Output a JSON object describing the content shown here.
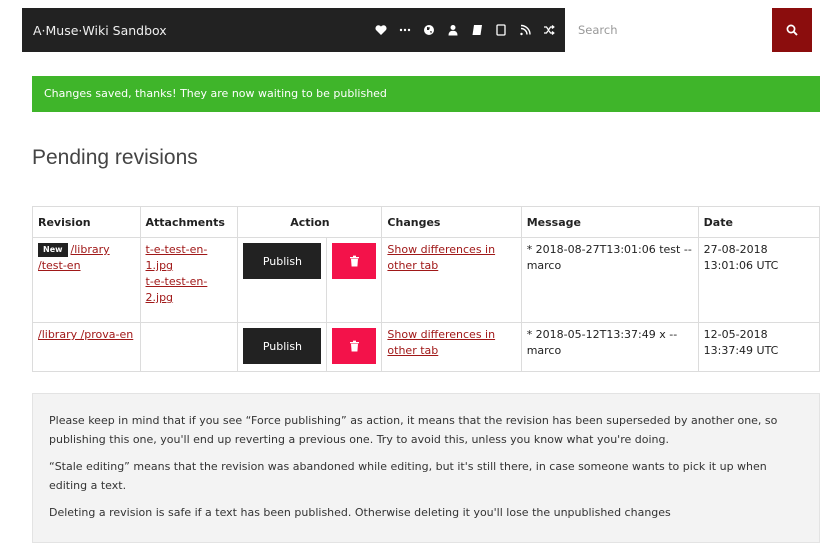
{
  "navbar": {
    "brand": "A·Muse·Wiki Sandbox",
    "icons": [
      "heart-icon",
      "more-icon",
      "globe-icon",
      "user-icon",
      "book-icon",
      "tablet-icon",
      "rss-icon",
      "shuffle-icon",
      "plus-icon"
    ],
    "search_placeholder": "Search",
    "search_button_color": "#8b0d0d"
  },
  "alert": {
    "text": "Changes saved, thanks! They are now waiting to be published",
    "color": "#3fb52a"
  },
  "page_title": "Pending revisions",
  "table": {
    "headers": {
      "revision": "Revision",
      "attachments": "Attachments",
      "action": "Action",
      "changes": "Changes",
      "message": "Message",
      "date": "Date"
    },
    "rows": [
      {
        "badge": "New",
        "revision": "/library /test-en",
        "attachments": [
          "t-e-test-en-1.jpg",
          "t-e-test-en-2.jpg"
        ],
        "publish": "Publish",
        "changes": "Show differences in other tab",
        "message": "* 2018-08-27T13:01:06 test -- marco",
        "date": "27-08-2018 13:01:06 UTC"
      },
      {
        "badge": "",
        "revision": "/library /prova-en",
        "attachments": [],
        "publish": "Publish",
        "changes": "Show differences in other tab",
        "message": "* 2018-05-12T13:37:49 x -- marco",
        "date": "12-05-2018 13:37:49 UTC"
      }
    ]
  },
  "info": {
    "p1": "Please keep in mind that if you see “Force publishing” as action, it means that the revision has been superseded by another one, so publishing this one, you'll end up reverting a previous one. Try to avoid this, unless you know what you're doing.",
    "p2": "“Stale editing” means that the revision was abandoned while editing, but it's still there, in case someone wants to pick it up when editing a text.",
    "p3": "Deleting a revision is safe if a text has been published. Otherwise deleting it you'll lose the unpublished changes"
  }
}
